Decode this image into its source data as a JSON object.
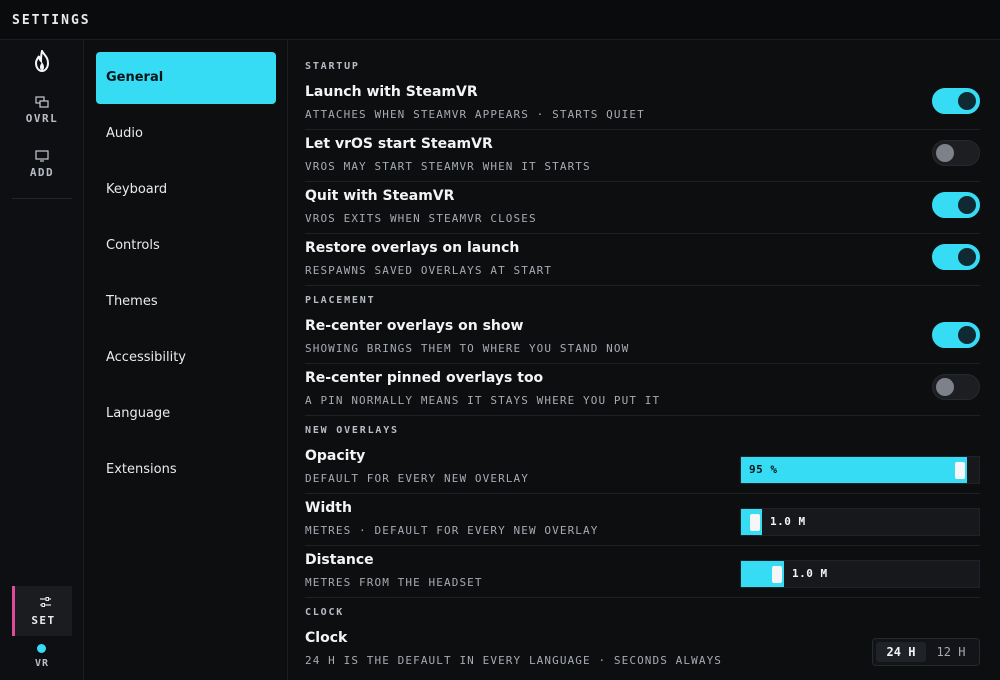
{
  "title": "SETTINGS",
  "rail": {
    "overlays_label": "OVRL",
    "add_label": "ADD",
    "settings_label": "SET",
    "vr_label": "VR"
  },
  "nav": {
    "items": [
      "General",
      "Audio",
      "Keyboard",
      "Controls",
      "Themes",
      "Accessibility",
      "Language",
      "Extensions"
    ],
    "active": "General"
  },
  "sections": {
    "startup": "STARTUP",
    "placement": "PLACEMENT",
    "new_overlays": "NEW OVERLAYS",
    "clock": "CLOCK"
  },
  "settings": {
    "launch": {
      "label": "Launch with SteamVR",
      "sub": "ATTACHES WHEN STEAMVR APPEARS · STARTS QUIET",
      "on": true
    },
    "letstart": {
      "label": "Let vrOS start SteamVR",
      "sub": "VROS MAY START STEAMVR WHEN IT STARTS",
      "on": false
    },
    "quit": {
      "label": "Quit with SteamVR",
      "sub": "VROS EXITS WHEN STEAMVR CLOSES",
      "on": true
    },
    "restore": {
      "label": "Restore overlays on launch",
      "sub": "RESPAWNS SAVED OVERLAYS AT START",
      "on": true
    },
    "recenter": {
      "label": "Re-center overlays on show",
      "sub": "SHOWING BRINGS THEM TO WHERE YOU STAND NOW",
      "on": true
    },
    "recenterpinned": {
      "label": "Re-center pinned overlays too",
      "sub": "A PIN NORMALLY MEANS IT STAYS WHERE YOU PUT IT",
      "on": false
    },
    "opacity": {
      "label": "Opacity",
      "sub": "DEFAULT FOR EVERY NEW OVERLAY",
      "value": "95 %",
      "fraction": 0.95
    },
    "width": {
      "label": "Width",
      "sub": "METRES · DEFAULT FOR EVERY NEW OVERLAY",
      "value": "1.0 M",
      "fraction": 0.09
    },
    "distance": {
      "label": "Distance",
      "sub": "METRES FROM THE HEADSET",
      "value": "1.0 M",
      "fraction": 0.18
    },
    "clock": {
      "label": "Clock",
      "sub": "24 H IS THE DEFAULT IN EVERY LANGUAGE · SECONDS ALWAYS",
      "options": [
        "24 H",
        "12 H"
      ],
      "selected": "24 H"
    }
  },
  "colors": {
    "accent": "#36dcf4",
    "set_marker": "#e04a9a"
  }
}
